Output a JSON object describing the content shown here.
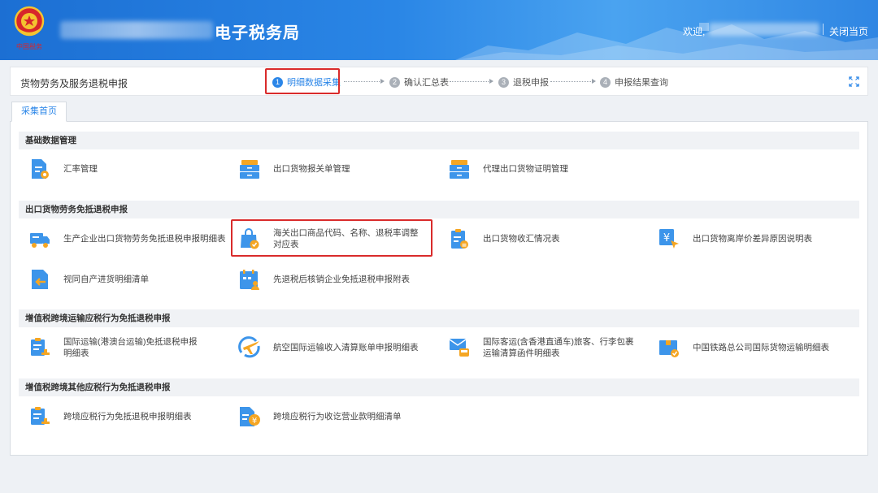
{
  "header": {
    "site_title": "电子税务局",
    "emblem_text": "中国税务",
    "welcome": "欢迎,",
    "close_page": "关闭当页"
  },
  "steps_bar": {
    "module_title": "货物劳务及服务退税申报",
    "steps": [
      {
        "num": "1",
        "label": "明细数据采集",
        "active": true
      },
      {
        "num": "2",
        "label": "确认汇总表",
        "active": false
      },
      {
        "num": "3",
        "label": "退税申报",
        "active": false
      },
      {
        "num": "4",
        "label": "申报结果查询",
        "active": false
      }
    ]
  },
  "tab": {
    "label": "采集首页"
  },
  "sections": [
    {
      "title": "基础数据管理",
      "items": [
        {
          "label": "汇率管理",
          "icon": "document-gear-icon"
        },
        {
          "label": "出口货物报关单管理",
          "icon": "cabinet-icon"
        },
        {
          "label": "代理出口货物证明管理",
          "icon": "cabinet-icon"
        }
      ]
    },
    {
      "title": "出口货物劳务免抵退税申报",
      "items": [
        {
          "label": "生产企业出口货物劳务免抵退税申报明细表",
          "icon": "delivery-truck-icon"
        },
        {
          "label": "海关出口商品代码、名称、退税率调整对应表",
          "icon": "shopping-bag-check-icon"
        },
        {
          "label": "出口货物收汇情况表",
          "icon": "clipboard-coin-icon"
        },
        {
          "label": "出口货物离岸价差异原因说明表",
          "icon": "yen-cursor-icon"
        },
        {
          "label": "视同自产进货明细清单",
          "icon": "document-return-icon"
        },
        {
          "label": "先退税后核销企业免抵退税申报附表",
          "icon": "calendar-user-icon"
        }
      ]
    },
    {
      "title": "增值税跨境运输应税行为免抵退税申报",
      "items": [
        {
          "label": "国际运输(港澳台运输)免抵退税申报明细表",
          "icon": "clipboard-stamp-icon"
        },
        {
          "label": "航空国际运输收入清算账单申报明细表",
          "icon": "airplane-globe-icon"
        },
        {
          "label": "国际客运(含香港直通车)旅客、行李包裹运输清算函件明细表",
          "icon": "mail-bus-icon"
        },
        {
          "label": "中国铁路总公司国际货物运输明细表",
          "icon": "box-check-icon"
        }
      ]
    },
    {
      "title": "增值税跨境其他应税行为免抵退税申报",
      "items": [
        {
          "label": "跨境应税行为免抵退税申报明细表",
          "icon": "clipboard-stamp-icon"
        },
        {
          "label": "跨境应税行为收讫营业款明细清单",
          "icon": "document-yen-icon"
        }
      ]
    }
  ],
  "colors": {
    "header_blue": "#2a86e6",
    "accent": "#2b86e8",
    "icon_blue": "#3d95ea",
    "icon_orange": "#f5a623",
    "highlight_red": "#d92b2b"
  }
}
